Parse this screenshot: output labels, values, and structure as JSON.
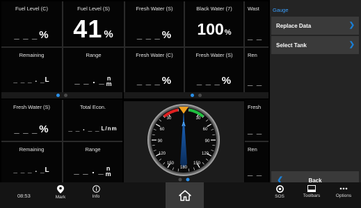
{
  "top_grid": {
    "tiles": [
      {
        "title": "Fuel Level (C)",
        "value": "_ _ _",
        "unit": "%"
      },
      {
        "title": "Fuel Level (S)",
        "value": "41",
        "unit": "%"
      },
      {
        "title": "Fresh Water (S)",
        "value": "_ _ _",
        "unit": "%"
      },
      {
        "title": "Black Water (7)",
        "value": "100",
        "unit": "%"
      },
      {
        "title": "Wast",
        "value": "_ _"
      },
      {
        "title": "Remaining",
        "value": "_ _ _ . _L"
      },
      {
        "title": "Range",
        "value": "_ _ . _",
        "unit_top": "n",
        "unit_bottom": "m"
      },
      {
        "title": "Fresh Water (C)",
        "value": "_ _ _",
        "unit": "%"
      },
      {
        "title": "Fresh Water (S)",
        "value": "_ _ _",
        "unit": "%"
      },
      {
        "title": "Ren",
        "value": "_ _"
      }
    ]
  },
  "bottom_grid": {
    "tiles": [
      {
        "title": "Fresh Water (S)",
        "value": "_ _ _",
        "unit": "%"
      },
      {
        "title": "Total Econ.",
        "value": "_ _ . _ _",
        "unit_top": "L",
        "unit_bottom": "nm"
      },
      {
        "title": "Remaining",
        "value": "_ _ _ . _L"
      },
      {
        "title": "Range",
        "value": "_ _ . _",
        "unit_top": "n",
        "unit_bottom": "m"
      }
    ],
    "right_tiles": [
      {
        "title": "Fresh",
        "value": "_ _"
      },
      {
        "title": "Ren",
        "value": "_ _"
      }
    ]
  },
  "gauge": {
    "ticks": [
      "30",
      "30",
      "60",
      "60",
      "90",
      "90",
      "120",
      "120",
      "150",
      "150",
      "180"
    ],
    "pointer_label": "A",
    "red_color": "#e02020",
    "green_color": "#20c040",
    "orange_color": "#f0a020"
  },
  "menu": {
    "header": "Gauge",
    "items": [
      "Replace Data",
      "Select Tank"
    ],
    "back_label": "Back"
  },
  "bottom_bar": {
    "time": "08:53",
    "mark_label": "Mark",
    "info_label": "Info",
    "sos_label": "SOS",
    "toolbars_label": "Toolbars",
    "options_label": "Options"
  },
  "colors": {
    "accent": "#2a8fe8",
    "panel": "#242424"
  }
}
